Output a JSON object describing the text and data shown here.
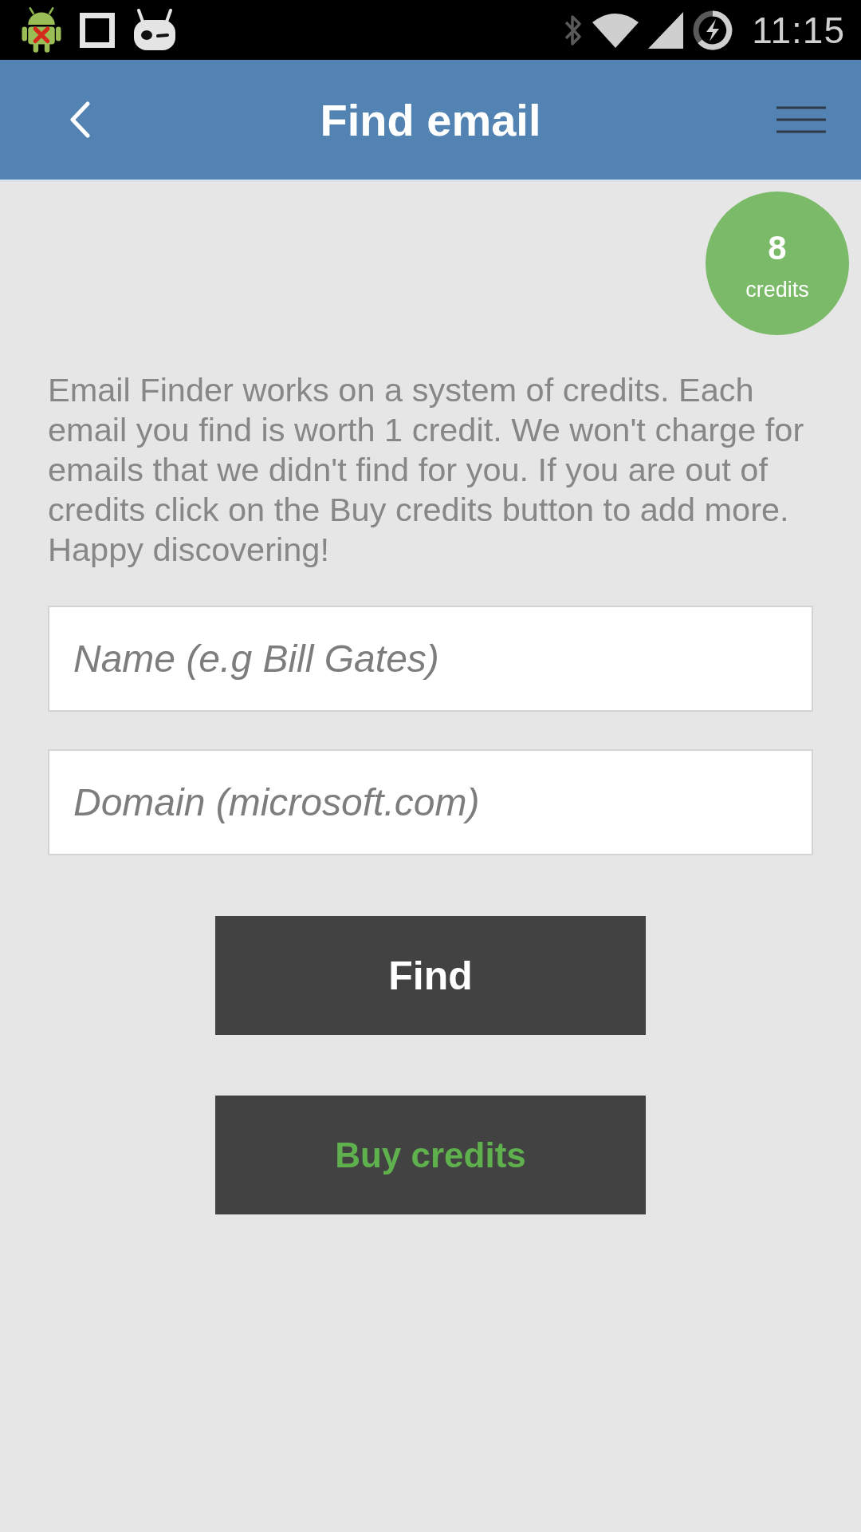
{
  "status_bar": {
    "time": "11:15"
  },
  "header": {
    "title": "Find email"
  },
  "credits": {
    "count": "8",
    "label": "credits"
  },
  "description": "Email Finder works on a system of credits. Each email you find is worth 1 credit. We won't charge for emails that we didn't find for you. If you are out of credits click on the Buy credits button to add more. Happy discovering!",
  "fields": [
    {
      "placeholder": "Name (e.g Bill Gates)"
    },
    {
      "placeholder": "Domain (microsoft.com)"
    }
  ],
  "buttons": [
    {
      "label": "Find",
      "kind": "primary"
    },
    {
      "label": "Buy credits",
      "kind": "purchase"
    }
  ]
}
